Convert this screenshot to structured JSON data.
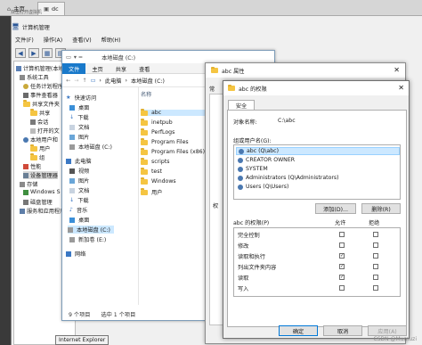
{
  "vm_tabs": [
    {
      "label": "主页"
    },
    {
      "label": "dc"
    }
  ],
  "vm_sub": "双击打开虚拟机",
  "computer_management": {
    "title": "计算机管理",
    "menu": [
      "文件(F)",
      "操作(A)",
      "查看(V)",
      "帮助(H)"
    ],
    "tree": [
      "计算机管理(本地)",
      "系统工具",
      "任务计划程序",
      "事件查看器",
      "共享文件夹",
      "共享",
      "会话",
      "打开的文",
      "本地用户和",
      "用户",
      "组",
      "性能",
      "设备管理器",
      "存储",
      "Windows S",
      "磁盘管理",
      "服务和应用程序"
    ]
  },
  "explorer": {
    "title_path": "本地磁盘 (C:)",
    "ribbon_tabs": [
      "文件",
      "主页",
      "共享",
      "查看"
    ],
    "address": [
      "此电脑",
      "本地磁盘 (C:)"
    ],
    "column_header": "名称",
    "nav": [
      "快速访问",
      "桌面",
      "下载",
      "文档",
      "图片",
      "本地磁盘 (C:)",
      "此电脑",
      "视频",
      "图片",
      "文档",
      "下载",
      "音乐",
      "桌面",
      "本地磁盘 (C:)",
      "新加卷 (E:)",
      "网络"
    ],
    "files": [
      "abc",
      "inetpub",
      "PerfLogs",
      "Program Files",
      "Program Files (x86)",
      "scripts",
      "test",
      "Windows",
      "用户"
    ],
    "status_count": "9 个项目",
    "status_selected": "选中 1 个项目"
  },
  "properties_dialog": {
    "title": "abc 属性",
    "tab_fragment": "常",
    "side_fragment": "权"
  },
  "permissions_dialog": {
    "title": "abc 的权限",
    "tab": "安全",
    "object_label": "对象名称:",
    "object_value": "C:\\abc",
    "groups_label": "组或用户名(G):",
    "groups": [
      "abc (Q\\abc)",
      "CREATOR OWNER",
      "SYSTEM",
      "Administrators (Q\\Administrators)",
      "Users (Q\\Users)"
    ],
    "add_button": "添加(D)...",
    "remove_button": "删除(R)",
    "perm_label": "abc 的权限(P)",
    "allow_header": "允许",
    "deny_header": "拒绝",
    "permissions": [
      {
        "name": "完全控制",
        "allow": false,
        "deny": false
      },
      {
        "name": "修改",
        "allow": false,
        "deny": false
      },
      {
        "name": "读取和执行",
        "allow": true,
        "deny": false
      },
      {
        "name": "列出文件夹内容",
        "allow": true,
        "deny": false
      },
      {
        "name": "读取",
        "allow": true,
        "deny": false
      },
      {
        "name": "写入",
        "allow": false,
        "deny": false
      }
    ],
    "ok_button": "确定",
    "cancel_button": "取消",
    "apply_button": "应用(A)"
  },
  "tooltip": "Internet Explorer",
  "watermark": "CSDN @Mumuzi"
}
